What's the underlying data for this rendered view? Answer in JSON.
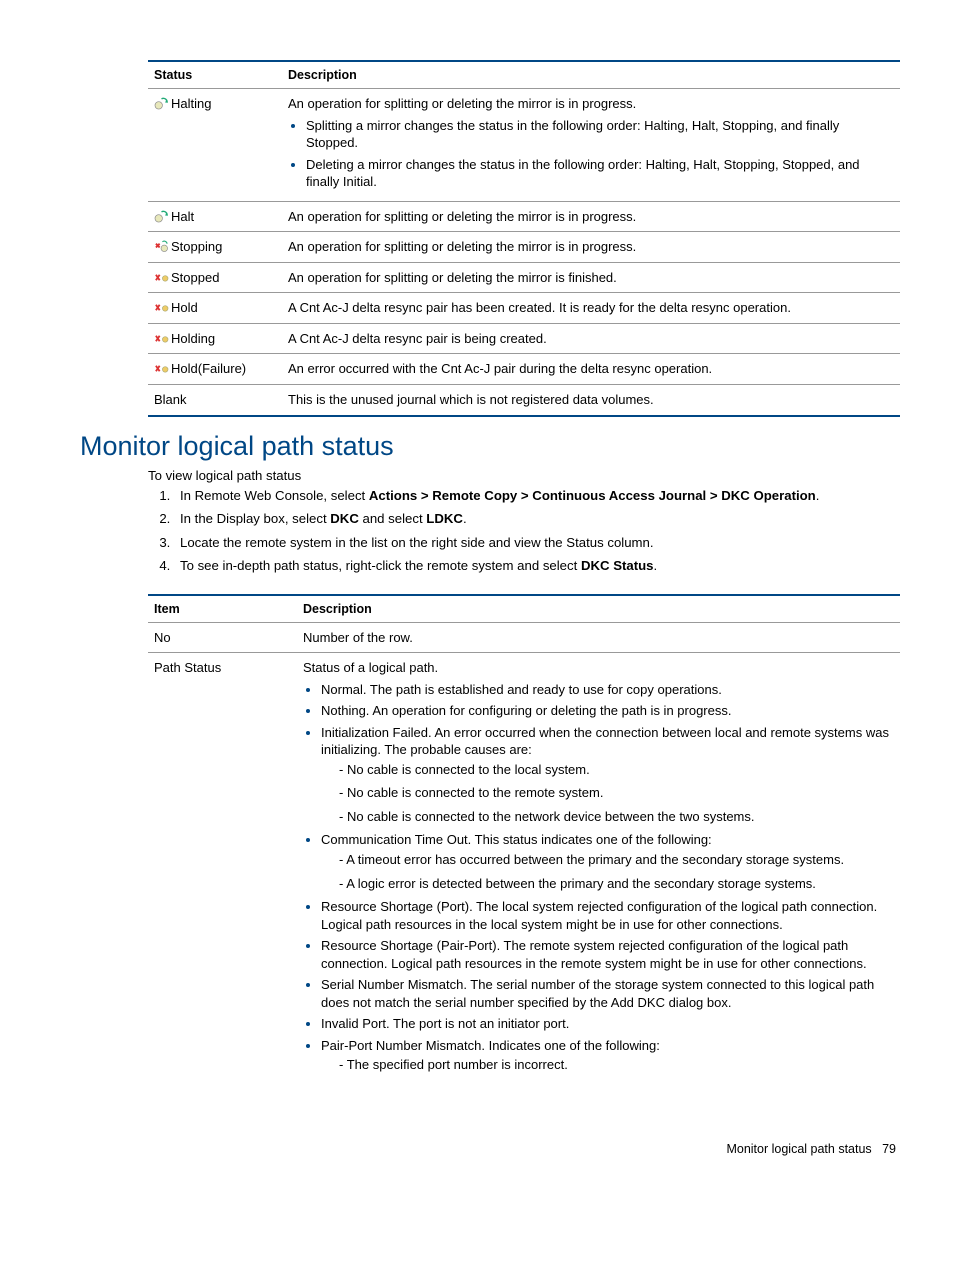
{
  "table1": {
    "headers": [
      "Status",
      "Description"
    ],
    "rows": [
      {
        "status": "Halting",
        "icon": "halting",
        "intro": "An operation for splitting or deleting the mirror is in progress.",
        "bullets": [
          "Splitting a mirror changes the status in the following order: Halting, Halt, Stopping, and finally Stopped.",
          "Deleting a mirror changes the status in the following order: Halting, Halt, Stopping, Stopped, and finally Initial."
        ]
      },
      {
        "status": "Halt",
        "icon": "halt",
        "desc": "An operation for splitting or deleting the mirror is in progress."
      },
      {
        "status": "Stopping",
        "icon": "stopping",
        "desc": "An operation for splitting or deleting the mirror is in progress."
      },
      {
        "status": "Stopped",
        "icon": "stopped",
        "desc": "An operation for splitting or deleting the mirror is finished."
      },
      {
        "status": "Hold",
        "icon": "hold",
        "desc": "A Cnt Ac-J delta resync pair has been created. It is ready for the delta resync operation."
      },
      {
        "status": "Holding",
        "icon": "holding",
        "desc": "A Cnt Ac-J delta resync pair is being created."
      },
      {
        "status": "Hold(Failure)",
        "icon": "holdfail",
        "desc": "An error occurred with the Cnt Ac-J pair during the delta resync operation."
      },
      {
        "status": "Blank",
        "icon": "",
        "desc": "This is the unused journal which is not registered data volumes."
      }
    ]
  },
  "section": {
    "heading": "Monitor logical path status",
    "intro": "To view logical path status",
    "step1_pre": "In Remote Web Console, select ",
    "step1_bold": "Actions > Remote Copy > Continuous Access Journal > DKC Operation",
    "step1_post": ".",
    "step2_pre": "In the Display box, select ",
    "step2_b1": "DKC",
    "step2_mid": " and select ",
    "step2_b2": "LDKC",
    "step2_post": ".",
    "step3": "Locate the remote system in the list on the right side and view the Status column.",
    "step4_pre": "To see in-depth path status, right-click the remote system and select ",
    "step4_bold": "DKC Status",
    "step4_post": "."
  },
  "table2": {
    "headers": [
      "Item",
      "Description"
    ],
    "rows": [
      {
        "item": "No",
        "desc": "Number of the row."
      },
      {
        "item": "Path Status",
        "intro": "Status of a logical path.",
        "b1": "Normal. The path is established and ready to use for copy operations.",
        "b2": "Nothing. An operation for configuring or deleting the path is in progress.",
        "b3": "Initialization Failed. An error occurred when the connection between local and remote systems was initializing. The probable causes are:",
        "b3s1": "- No cable is connected to the local system.",
        "b3s2": "- No cable is connected to the remote system.",
        "b3s3": "- No cable is connected to the network device between the two systems.",
        "b4": "Communication Time Out. This status indicates one of the following:",
        "b4s1": "- A timeout error has occurred between the primary and the secondary storage systems.",
        "b4s2": "- A logic error is detected between the primary and the secondary storage systems.",
        "b5": "Resource Shortage (Port). The local system rejected configuration of the logical path connection. Logical path resources in the local system might be in use for other connections.",
        "b6": "Resource Shortage (Pair-Port). The remote system rejected configuration of the logical path connection. Logical path resources in the remote system might be in use for other connections.",
        "b7": "Serial Number Mismatch. The serial number of the storage system connected to this logical path does not match the serial number specified by the Add DKC dialog box.",
        "b8": "Invalid Port. The port is not an initiator port.",
        "b9": "Pair-Port Number Mismatch. Indicates one of the following:",
        "b9s1": "- The specified port number is incorrect."
      }
    ]
  },
  "footer": {
    "title": "Monitor logical path status",
    "page": "79"
  }
}
